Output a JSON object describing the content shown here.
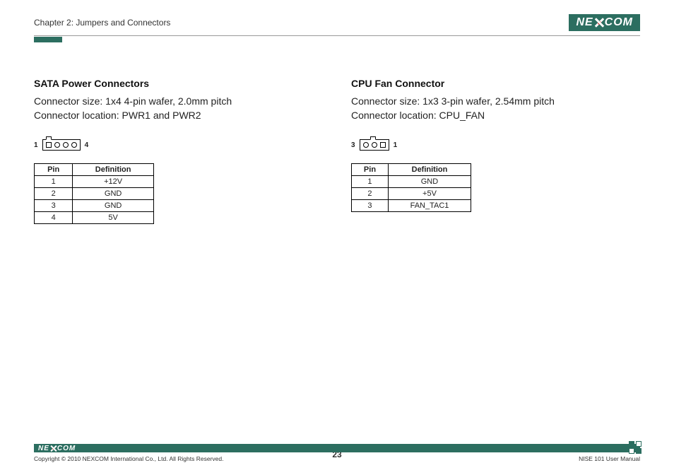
{
  "header": {
    "chapter": "Chapter 2: Jumpers and Connectors",
    "brand_left": "NE",
    "brand_right": "COM"
  },
  "left": {
    "title": "SATA Power Connectors",
    "line1": "Connector size: 1x4 4-pin wafer, 2.0mm pitch",
    "line2": "Connector location: PWR1 and PWR2",
    "label_left": "1",
    "label_right": "4",
    "table": {
      "h1": "Pin",
      "h2": "Definition",
      "rows": [
        {
          "pin": "1",
          "def": "+12V"
        },
        {
          "pin": "2",
          "def": "GND"
        },
        {
          "pin": "3",
          "def": "GND"
        },
        {
          "pin": "4",
          "def": "5V"
        }
      ]
    }
  },
  "right": {
    "title": "CPU Fan Connector",
    "line1": "Connector size: 1x3 3-pin wafer, 2.54mm pitch",
    "line2": "Connector location: CPU_FAN",
    "label_left": "3",
    "label_right": "1",
    "table": {
      "h1": "Pin",
      "h2": "Definition",
      "rows": [
        {
          "pin": "1",
          "def": "GND"
        },
        {
          "pin": "2",
          "def": "+5V"
        },
        {
          "pin": "3",
          "def": "FAN_TAC1"
        }
      ]
    }
  },
  "footer": {
    "copyright": "Copyright © 2010 NEXCOM International Co., Ltd. All Rights Reserved.",
    "page": "23",
    "manual": "NISE 101 User Manual"
  }
}
